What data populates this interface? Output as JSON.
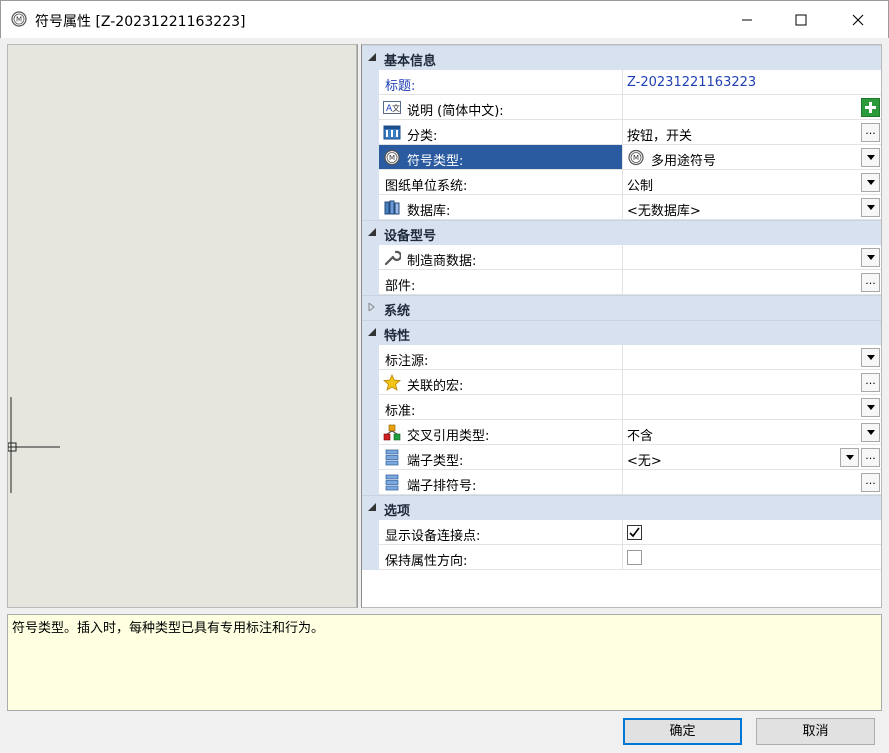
{
  "window": {
    "title": "符号属性 [Z-20231221163223]",
    "icon": "symbol-m-icon"
  },
  "grid": {
    "categories": [
      {
        "label": "基本信息",
        "expanded": true
      },
      {
        "label": "设备型号",
        "expanded": true
      },
      {
        "label": "系统",
        "expanded": false
      },
      {
        "label": "特性",
        "expanded": true
      },
      {
        "label": "选项",
        "expanded": true
      }
    ],
    "properties": {
      "title": {
        "name": "标题:",
        "value": "Z-20231221163223"
      },
      "description": {
        "name": "说明 (简体中文):",
        "value": "",
        "icon": "translate-icon"
      },
      "classification": {
        "name": "分类:",
        "value": "按钮，开关",
        "icon": "classification-icon"
      },
      "symbol_type": {
        "name": "符号类型:",
        "value": "多用途符号",
        "icon": "symbol-m-icon",
        "selected": true
      },
      "unit_system": {
        "name": "图纸单位系统:",
        "value": "公制"
      },
      "database": {
        "name": "数据库:",
        "value": "<无数据库>",
        "icon": "database-icon"
      },
      "manufacturer": {
        "name": "制造商数据:",
        "value": "",
        "icon": "wrench-icon"
      },
      "component": {
        "name": "部件:",
        "value": ""
      },
      "annotation_source": {
        "name": "标注源:",
        "value": ""
      },
      "macro": {
        "name": "关联的宏:",
        "value": "",
        "icon": "star-icon"
      },
      "standard": {
        "name": "标准:",
        "value": ""
      },
      "cross_ref": {
        "name": "交叉引用类型:",
        "value": "不含",
        "icon": "cross-reference-icon"
      },
      "terminal_type": {
        "name": "端子类型:",
        "value": "<无>",
        "icon": "terminal-icon"
      },
      "terminal_seq": {
        "name": "端子排符号:",
        "value": "",
        "icon": "terminal-icon"
      },
      "show_connection": {
        "name": "显示设备连接点:",
        "checked": true
      },
      "keep_orientation": {
        "name": "保持属性方向:",
        "checked": false
      }
    }
  },
  "description_pane": {
    "text": "符号类型。插入时，每种类型已具有专用标注和行为。"
  },
  "buttons": {
    "ok": "确定",
    "cancel": "取消"
  },
  "colors": {
    "category_bg": "#d7e1f0",
    "selected_bg": "#2a5aa0",
    "desc_bg": "#ffffe1",
    "link_blue": "#1f3fb5"
  }
}
